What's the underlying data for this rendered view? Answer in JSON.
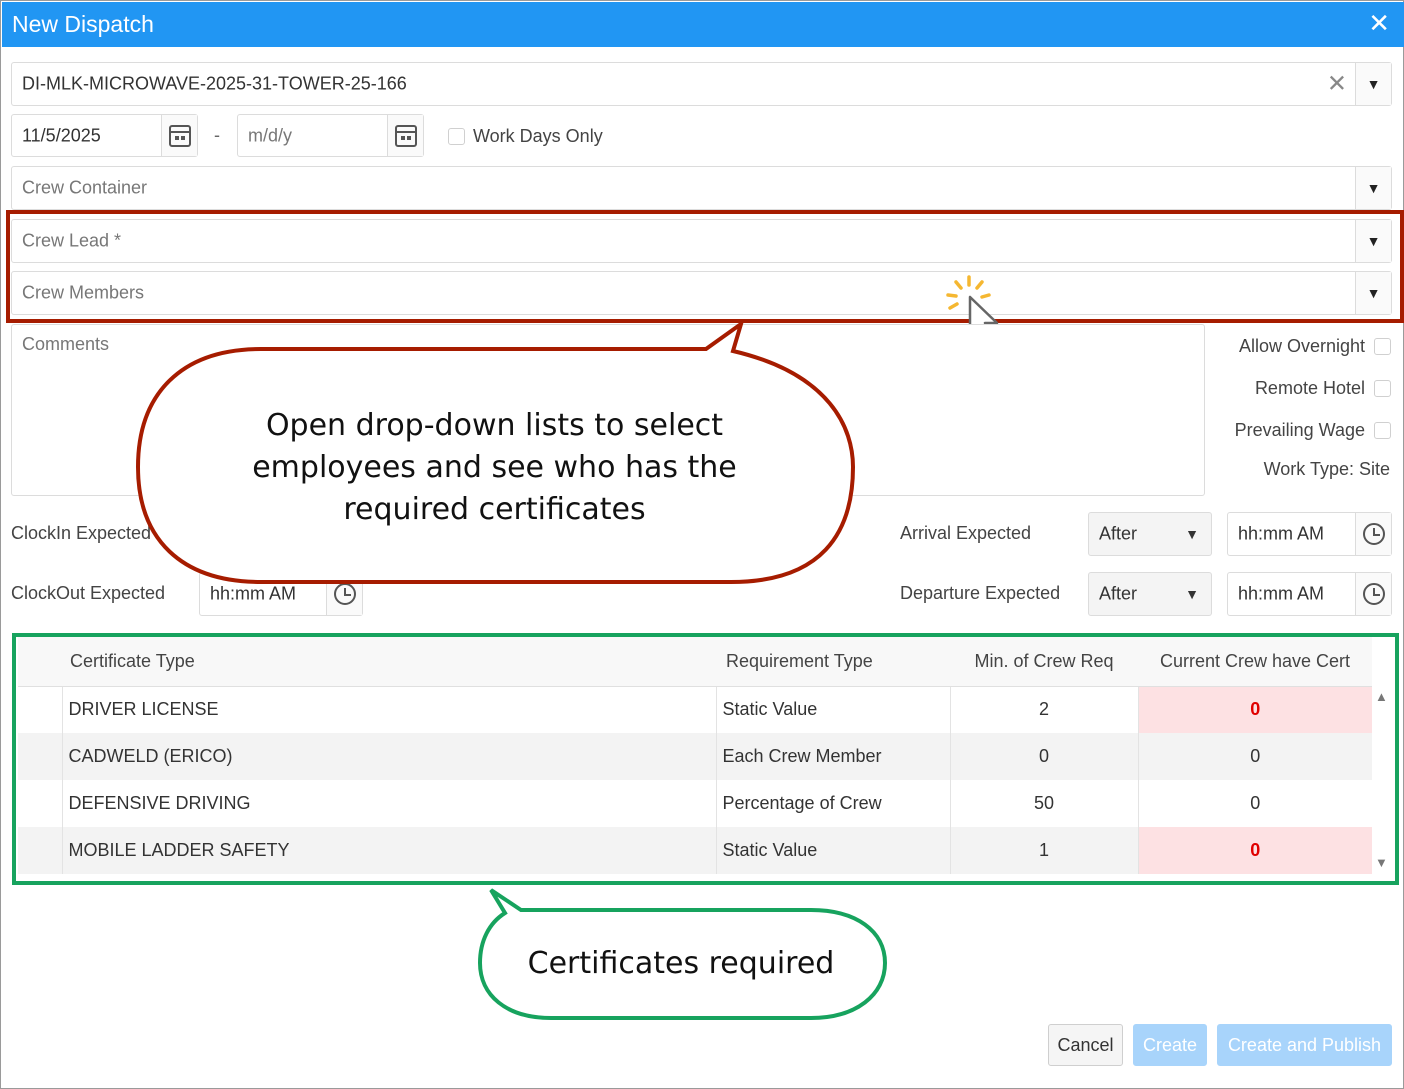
{
  "dialog": {
    "title": "New Dispatch",
    "close_icon": "close-icon"
  },
  "job": {
    "value": "DI-MLK-MICROWAVE-2025-31-TOWER-25-166"
  },
  "dates": {
    "start": "11/5/2025",
    "separator": "-",
    "end_placeholder": "m/d/y",
    "work_days_only": "Work Days Only"
  },
  "crew": {
    "container_placeholder": "Crew Container",
    "lead_placeholder": "Crew Lead *",
    "members_placeholder": "Crew Members"
  },
  "comments_placeholder": "Comments",
  "options": {
    "allow_overnight": "Allow Overnight",
    "remote_hotel": "Remote Hotel",
    "prevailing_wage": "Prevailing Wage",
    "work_type": "Work Type: Site"
  },
  "times": {
    "clockin_label": "ClockIn Expected",
    "clockout_label": "ClockOut Expected",
    "clockout_placeholder": "hh:mm AM",
    "arrival_label": "Arrival Expected",
    "arrival_mode": "After",
    "arrival_placeholder": "hh:mm AM",
    "departure_label": "Departure Expected",
    "departure_mode": "After",
    "departure_placeholder": "hh:mm AM"
  },
  "cert_table": {
    "headers": [
      "Certificate Type",
      "Requirement Type",
      "Min. of Crew Req",
      "Current Crew have Cert"
    ],
    "rows": [
      {
        "type": "DRIVER LICENSE",
        "req": "Static Value",
        "min": "2",
        "cur": "0",
        "short": true
      },
      {
        "type": "CADWELD (ERICO)",
        "req": "Each Crew Member",
        "min": "0",
        "cur": "0",
        "short": false
      },
      {
        "type": "DEFENSIVE DRIVING",
        "req": "Percentage of Crew",
        "min": "50",
        "cur": "0",
        "short": false
      },
      {
        "type": "MOBILE LADDER SAFETY",
        "req": "Static Value",
        "min": "1",
        "cur": "0",
        "short": true
      }
    ]
  },
  "callouts": {
    "dropdown_line1": "Open drop-down lists to select",
    "dropdown_line2": "employees and see who has the",
    "dropdown_line3": "required certificates",
    "certs": "Certificates required"
  },
  "buttons": {
    "cancel": "Cancel",
    "create": "Create",
    "create_publish": "Create and Publish"
  },
  "colors": {
    "header": "#2196f3",
    "red_outline": "#a61c00",
    "green_outline": "#17a35e",
    "missing_cert_bg": "#fde1e3",
    "missing_cert_text": "#e00000"
  }
}
